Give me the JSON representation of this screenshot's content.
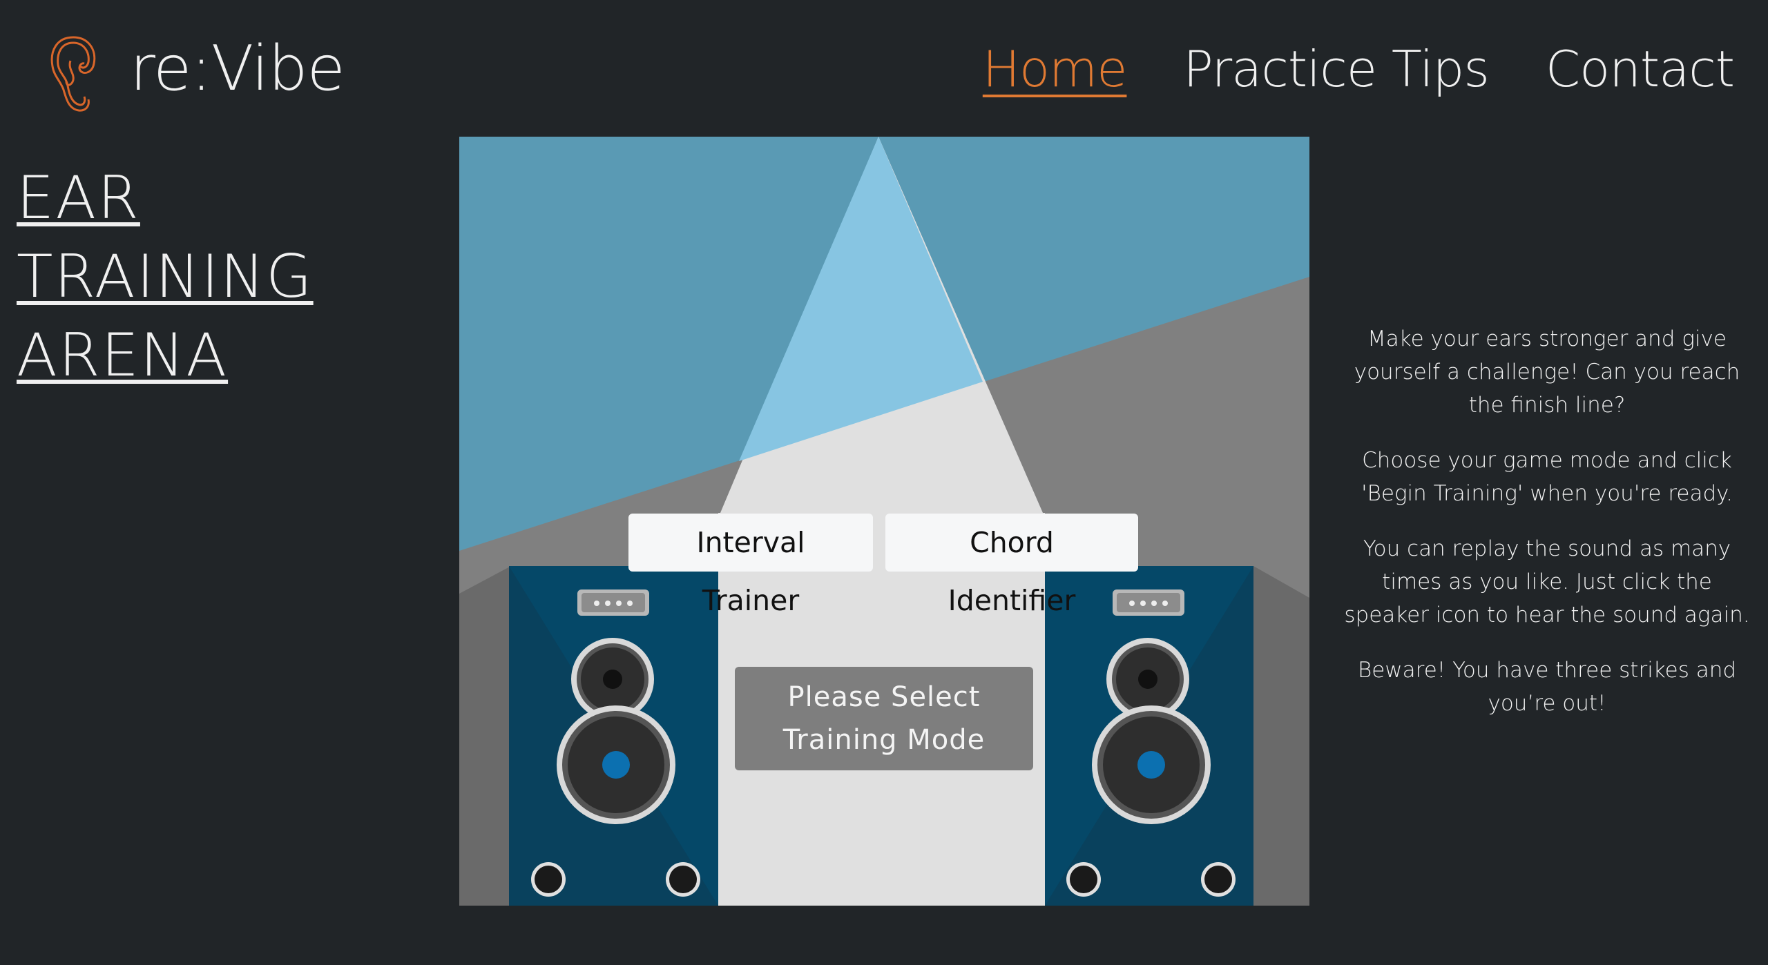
{
  "header": {
    "brand": "re:Vibe",
    "logo_icon": "ear-icon",
    "nav": [
      {
        "label": "Home",
        "active": true
      },
      {
        "label": "Practice Tips",
        "active": false
      },
      {
        "label": "Contact",
        "active": false
      }
    ]
  },
  "page_title": {
    "lines": [
      "EAR",
      "TRAINING",
      "ARENA"
    ]
  },
  "stage": {
    "mode_buttons": [
      {
        "label": "Interval Trainer"
      },
      {
        "label": "Chord Identifier"
      }
    ],
    "status": "Please Select Training Mode",
    "speaker_icons": [
      "speaker-left-icon",
      "speaker-right-icon"
    ]
  },
  "info": {
    "paragraphs": [
      "Make your ears stronger and give yourself a challenge! Can you reach the finish line?",
      "Choose your game mode and click 'Begin Training' when you're ready.",
      "You can replay the sound as many times as you like. Just click the speaker icon to hear the sound again.",
      "Beware! You have three strikes and you’re out!"
    ]
  },
  "colors": {
    "background": "#212528",
    "accent": "#e07a33",
    "sky": "#5a9ab4",
    "spotlight": "#87c5e2",
    "speaker_blue": "#054868"
  }
}
